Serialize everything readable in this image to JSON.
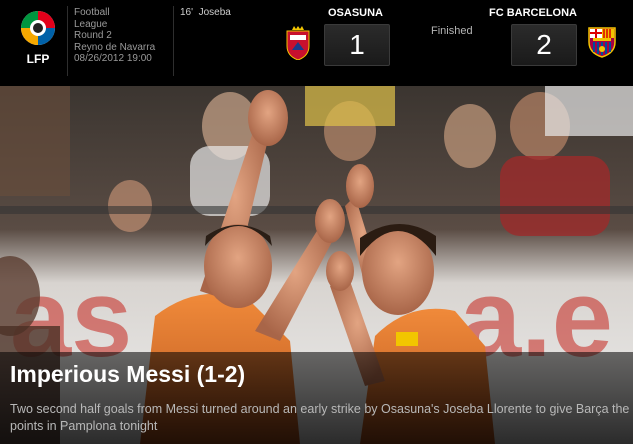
{
  "header": {
    "logo_text": "LFP",
    "match_info": {
      "sport": "Football",
      "competition": "League",
      "round": "Round 2",
      "venue": "Reyno de Navarra",
      "datetime": "08/26/2012 19:00"
    },
    "scorer": "16'  Joseba",
    "status": "Finished",
    "home": {
      "name": "OSASUNA",
      "score": "1",
      "crest_icon": "osasuna-crest-icon",
      "color": "#c8102e"
    },
    "away": {
      "name": "FC BARCELONA",
      "score": "2",
      "crest_icon": "barcelona-crest-icon",
      "color": "#a50044"
    }
  },
  "article": {
    "headline": "Imperious Messi (1-2)",
    "summary": "Two second half goals from Messi turned around an early strike by Osasuna's Joseba Llorente to give Barça the points in Pamplona tonight"
  },
  "colors": {
    "header_bg": "#000000",
    "kit_orange": "#e07a2c",
    "caption_text": "#b8b8b8"
  }
}
